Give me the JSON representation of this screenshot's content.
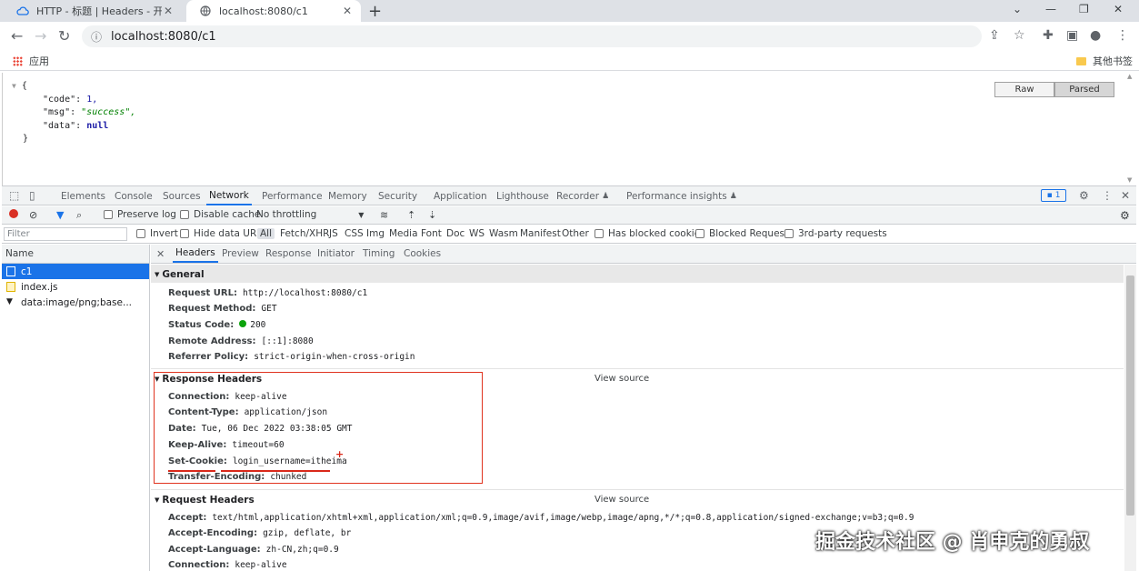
{
  "browser": {
    "tabs": [
      {
        "title": "HTTP - 标题 | Headers - 开发者"
      },
      {
        "title": "localhost:8080/c1"
      }
    ],
    "url": "localhost:8080/c1",
    "bookmarks": {
      "apps": "应用",
      "other": "其他书签"
    }
  },
  "page": {
    "json_lines": {
      "open": "{",
      "code_key": "\"code\":",
      "code_val": "1,",
      "msg_key": "\"msg\":",
      "msg_val": "\"success\",",
      "data_key": "\"data\":",
      "data_val": "null",
      "close": "}"
    },
    "view_modes": {
      "raw": "Raw",
      "parsed": "Parsed"
    }
  },
  "devtools": {
    "tabs": [
      "Elements",
      "Console",
      "Sources",
      "Network",
      "Performance",
      "Memory",
      "Security",
      "Application",
      "Lighthouse",
      "Recorder",
      "Performance insights"
    ],
    "active_tab": "Network",
    "issues_count": "1",
    "toolbar": {
      "preserve_log": "Preserve log",
      "disable_cache": "Disable cache",
      "throttling": "No throttling"
    },
    "filter": {
      "placeholder": "Filter",
      "invert": "Invert",
      "hide_data_urls": "Hide data URLs",
      "types": [
        "All",
        "Fetch/XHR",
        "JS",
        "CSS",
        "Img",
        "Media",
        "Font",
        "Doc",
        "WS",
        "Wasm",
        "Manifest",
        "Other"
      ],
      "has_blocked_cookies": "Has blocked cookies",
      "blocked_requests": "Blocked Requests",
      "third_party": "3rd-party requests"
    },
    "requests": {
      "header": "Name",
      "items": [
        "c1",
        "index.js",
        "data:image/png;base..."
      ]
    },
    "detail_tabs": [
      "Headers",
      "Preview",
      "Response",
      "Initiator",
      "Timing",
      "Cookies"
    ],
    "general": {
      "title": "General",
      "rows": [
        {
          "k": "Request URL:",
          "v": "http://localhost:8080/c1"
        },
        {
          "k": "Request Method:",
          "v": "GET"
        },
        {
          "k": "Status Code:",
          "v": "200"
        },
        {
          "k": "Remote Address:",
          "v": "[::1]:8080"
        },
        {
          "k": "Referrer Policy:",
          "v": "strict-origin-when-cross-origin"
        }
      ]
    },
    "response_headers": {
      "title": "Response Headers",
      "view_source": "View source",
      "rows": [
        {
          "k": "Connection:",
          "v": "keep-alive"
        },
        {
          "k": "Content-Type:",
          "v": "application/json"
        },
        {
          "k": "Date:",
          "v": "Tue, 06 Dec 2022 03:38:05 GMT"
        },
        {
          "k": "Keep-Alive:",
          "v": "timeout=60"
        },
        {
          "k": "Set-Cookie:",
          "v": "login_username=itheima"
        },
        {
          "k": "Transfer-Encoding:",
          "v": "chunked"
        }
      ],
      "annotation": "+"
    },
    "request_headers": {
      "title": "Request Headers",
      "view_source": "View source",
      "rows": [
        {
          "k": "Accept:",
          "v": "text/html,application/xhtml+xml,application/xml;q=0.9,image/avif,image/webp,image/apng,*/*;q=0.8,application/signed-exchange;v=b3;q=0.9"
        },
        {
          "k": "Accept-Encoding:",
          "v": "gzip, deflate, br"
        },
        {
          "k": "Accept-Language:",
          "v": "zh-CN,zh;q=0.9"
        },
        {
          "k": "Connection:",
          "v": "keep-alive"
        }
      ]
    }
  },
  "watermark": "掘金技术社区 @ 肖申克的勇叔"
}
